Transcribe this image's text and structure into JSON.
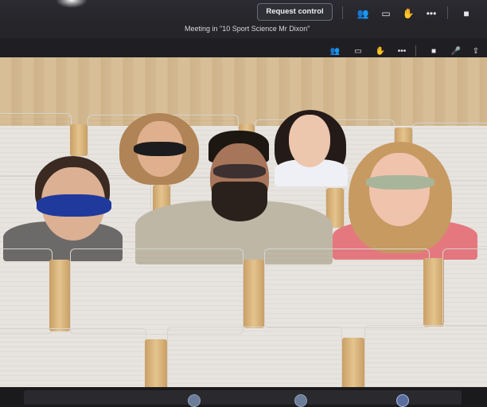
{
  "toolbar": {
    "request_control_label": "Request control",
    "icons": [
      "people-icon",
      "chat-icon",
      "raise-hand-icon",
      "more-icon",
      "camera-icon"
    ]
  },
  "meeting": {
    "title": "Meeting in \"10 Sport Science Mr Dixon\""
  },
  "secondary_toolbar": {
    "icons": [
      "people-icon",
      "chat-icon",
      "raise-hand-icon",
      "more-icon",
      "camera-icon",
      "mic-icon",
      "share-icon"
    ]
  },
  "colors": {
    "toolbar_bg": "#2b2b31",
    "wall_wood": "#d7be97",
    "seat_white": "#f2f1ee"
  }
}
